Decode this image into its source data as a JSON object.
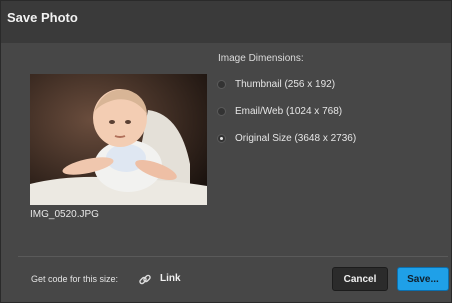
{
  "dialog": {
    "title": "Save Photo",
    "filename": "IMG_0520.JPG",
    "dimensions_label": "Image Dimensions:",
    "options": [
      {
        "label": "Thumbnail (256 x 192)",
        "checked": false
      },
      {
        "label": "Email/Web (1024 x 768)",
        "checked": false
      },
      {
        "label": "Original Size (3648 x 2736)",
        "checked": true
      }
    ]
  },
  "footer": {
    "code_label": "Get code for this size:",
    "link_label": "Link",
    "link_icon": "link-icon",
    "cancel_label": "Cancel",
    "save_label": "Save..."
  },
  "colors": {
    "accent": "#1fa0e8",
    "panel": "#474747"
  }
}
